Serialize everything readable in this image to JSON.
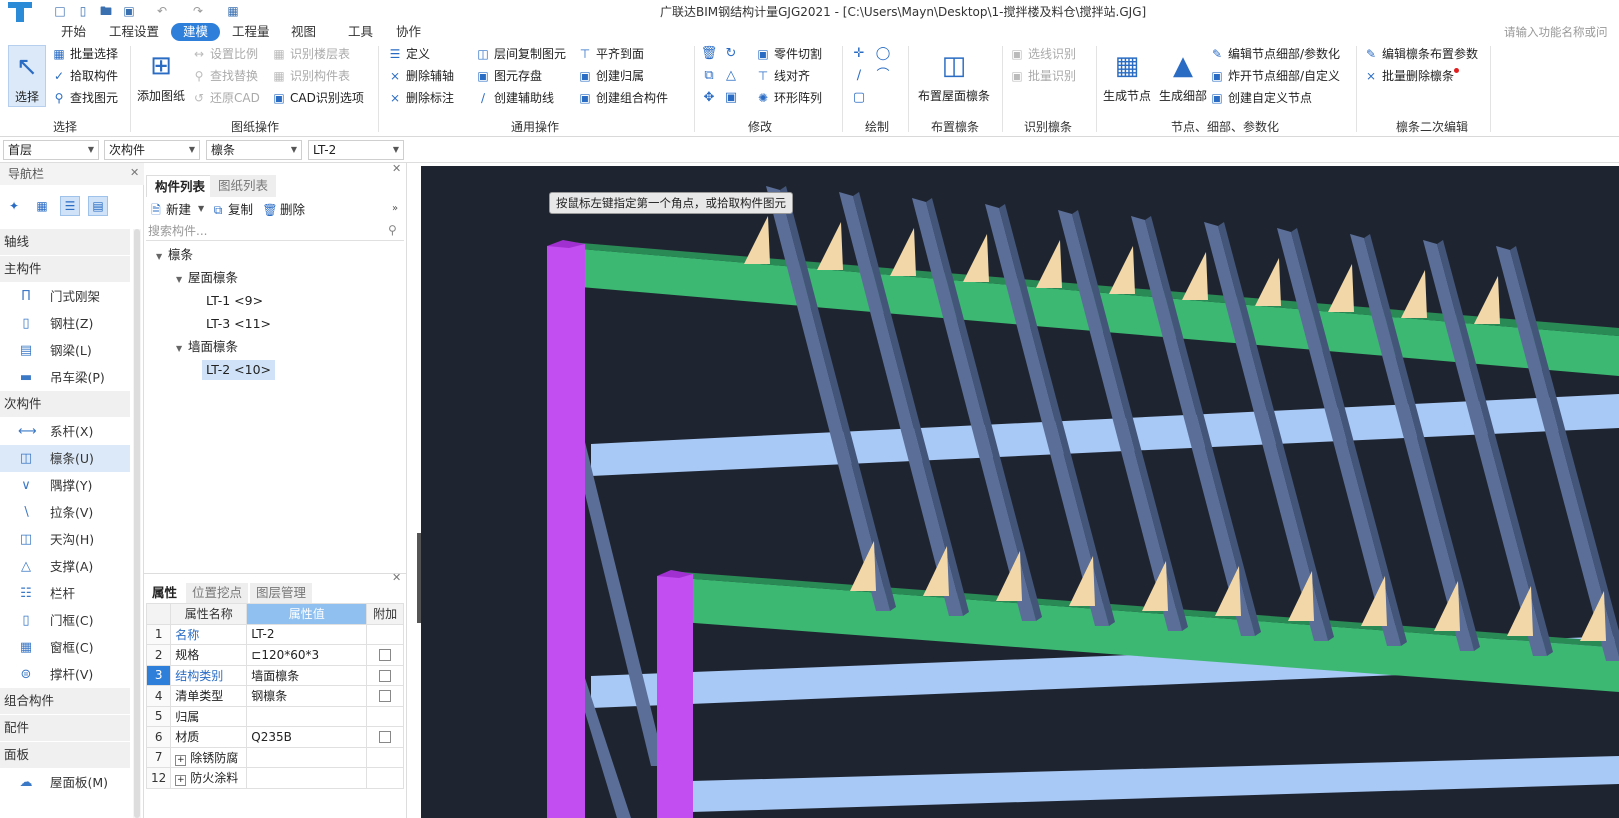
{
  "title": "广联达BIM钢结构计量GJG2021 - [C:\\Users\\Mayn\\Desktop\\1-搅拌楼及料仓\\搅拌站.GJG]",
  "menu": [
    "开始",
    "工程设置",
    "建模",
    "工程量",
    "视图",
    "工具",
    "协作"
  ],
  "menu_active": "建模",
  "search_function_placeholder": "请输入功能名称或问",
  "ribbon": {
    "select": {
      "big": "选择",
      "items": [
        "批量选择",
        "拾取构件",
        "查找图元"
      ],
      "label": "选择"
    },
    "drawing": {
      "big": "添加图纸",
      "items": [
        "设置比例",
        "查找替换",
        "还原CAD",
        "识别楼层表",
        "识别构件表",
        "CAD识别选项"
      ],
      "label": "图纸操作"
    },
    "common": {
      "items": [
        "定义",
        "删除辅轴",
        "删除标注",
        "层间复制图元",
        "图元存盘",
        "创建辅助线",
        "平齐到面",
        "创建归属",
        "创建组合构件"
      ],
      "label": "通用操作"
    },
    "modify": {
      "items": [
        "零件切割",
        "线对齐",
        "环形阵列"
      ],
      "label": "修改"
    },
    "draw": {
      "label": "绘制"
    },
    "purlin_layout": {
      "big": "布置屋面檩条",
      "label": "布置檩条"
    },
    "recognize": {
      "items": [
        "选线识别",
        "批量识别"
      ],
      "label": "识别檩条"
    },
    "node": {
      "big1": "生成节点",
      "big2": "生成细部",
      "items": [
        "编辑节点细部/参数化",
        "炸开节点细部/自定义",
        "创建自定义节点"
      ],
      "label": "节点、细部、参数化"
    },
    "purlin_edit": {
      "items": [
        "编辑檩条布置参数",
        "批量删除檩条"
      ],
      "label": "檩条二次编辑"
    }
  },
  "dropdowns": [
    "首层",
    "次构件",
    "檩条",
    "LT-2"
  ],
  "nav": {
    "title": "导航栏",
    "categories": [
      {
        "name": "轴线",
        "items": []
      },
      {
        "name": "主构件",
        "items": [
          "门式刚架",
          "钢柱(Z)",
          "钢梁(L)",
          "吊车梁(P)"
        ]
      },
      {
        "name": "次构件",
        "items": [
          "系杆(X)",
          "檩条(U)",
          "隅撑(Y)",
          "拉条(V)",
          "天沟(H)",
          "支撑(A)",
          "栏杆",
          "门框(C)",
          "窗框(C)",
          "撑杆(V)"
        ]
      },
      {
        "name": "组合构件",
        "items": []
      },
      {
        "name": "配件",
        "items": []
      },
      {
        "name": "面板",
        "items": [
          "屋面板(M)"
        ]
      }
    ],
    "selected": "檩条(U)"
  },
  "component_list": {
    "tabs": [
      "构件列表",
      "图纸列表"
    ],
    "toolbar": [
      "新建",
      "复制",
      "删除"
    ],
    "search_placeholder": "搜索构件...",
    "tree": {
      "root": "檩条",
      "groups": [
        {
          "name": "屋面檩条",
          "items": [
            "LT-1 <9>",
            "LT-3 <11>"
          ]
        },
        {
          "name": "墙面檩条",
          "items": [
            "LT-2 <10>"
          ]
        }
      ]
    },
    "selected": "LT-2 <10>"
  },
  "properties": {
    "tabs": [
      "属性",
      "位置挖点",
      "图层管理"
    ],
    "headers": [
      "属性名称",
      "属性值",
      "附加"
    ],
    "rows": [
      {
        "n": "1",
        "name": "名称",
        "value": "LT-2",
        "check": false
      },
      {
        "n": "2",
        "name": "规格",
        "value": "⊏120*60*3",
        "check": true
      },
      {
        "n": "3",
        "name": "结构类别",
        "value": "墙面檩条",
        "check": true
      },
      {
        "n": "4",
        "name": "清单类型",
        "value": "钢檩条",
        "check": true
      },
      {
        "n": "5",
        "name": "归属",
        "value": "",
        "check": false
      },
      {
        "n": "6",
        "name": "材质",
        "value": "Q235B",
        "check": true
      },
      {
        "n": "7",
        "name": "除锈防腐",
        "value": "",
        "check": false
      },
      {
        "n": "12",
        "name": "防火涂料",
        "value": "",
        "check": false
      }
    ]
  },
  "viewport": {
    "tooltip": "按鼠标左键指定第一个角点，或拾取构件图元",
    "colors": {
      "background": "#1f2530",
      "column": "#c24df0",
      "beam": "#3cb873",
      "tie": "#a8c8f5",
      "purlin": "#5a6e98",
      "bracket": "#f2d8a8"
    }
  }
}
